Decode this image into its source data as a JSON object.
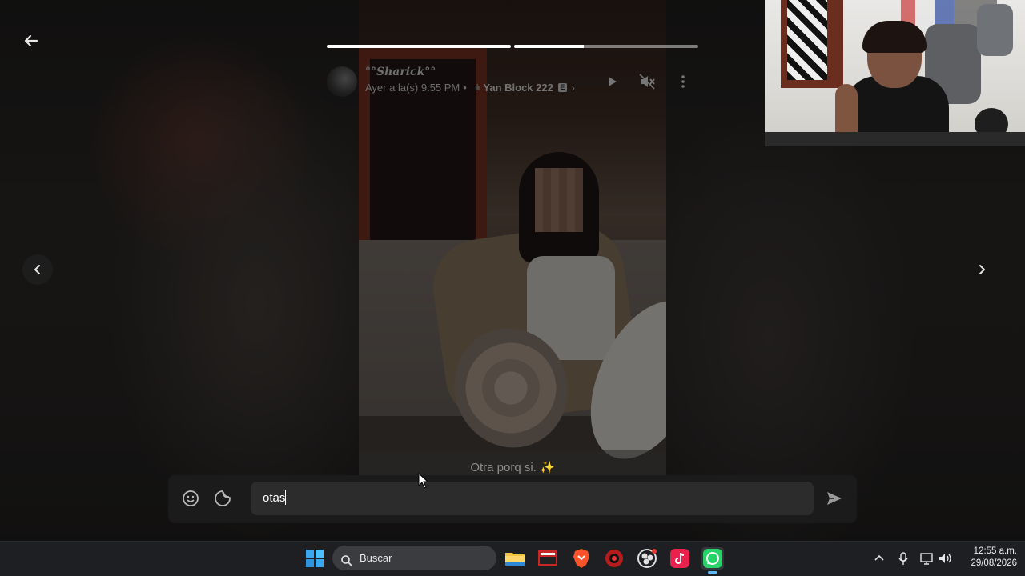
{
  "status": {
    "author_name": "°°Sharick°°",
    "time_label": "Ayer a la(s) 9:55 PM",
    "separator": "•",
    "song": "Yan Block 222",
    "explicit_badge": "E",
    "caption": "Otra porq si. ✨",
    "progress": [
      1.0,
      0.38
    ]
  },
  "reply": {
    "input_value": "otas"
  },
  "taskbar": {
    "search_label": "Buscar",
    "apps": [
      "windows-start-icon",
      "file-explorer-icon",
      "voicemeeter-icon",
      "brave-browser-icon",
      "app-red-icon",
      "obs-icon",
      "tiktok-icon",
      "whatsapp-icon"
    ],
    "time": "12:55 a.m.",
    "date": "29/08/2026"
  },
  "colors": {
    "whatsapp": "#25d366",
    "tiktok": "#e8214d",
    "brave": "#fb542b"
  }
}
